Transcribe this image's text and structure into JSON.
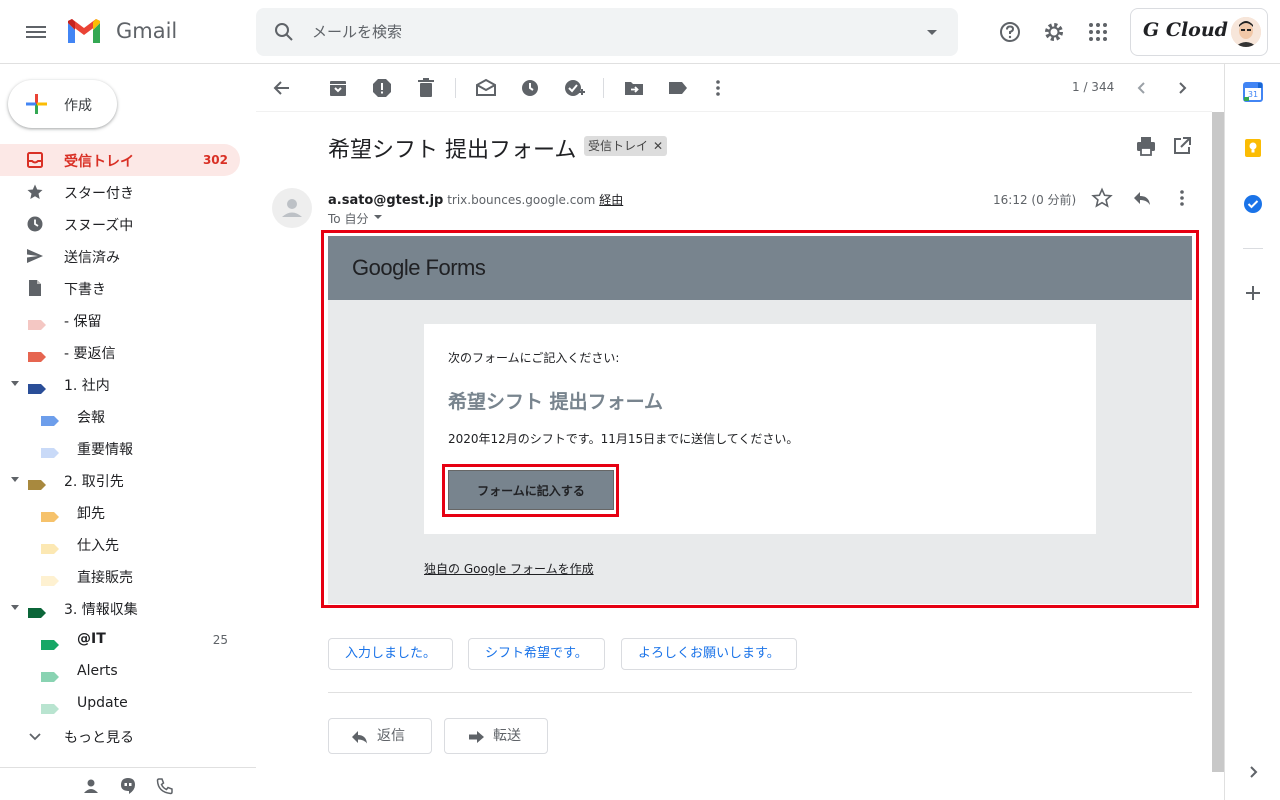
{
  "header": {
    "app_name": "Gmail",
    "search_placeholder": "メールを検索",
    "account_brand": "G Cloud"
  },
  "sidebar": {
    "compose_label": "作成",
    "items": [
      {
        "label": "受信トレイ",
        "count": "302",
        "icon": "inbox-icon"
      },
      {
        "label": "スター付き",
        "count": "",
        "icon": "star-icon"
      },
      {
        "label": "スヌーズ中",
        "count": "",
        "icon": "clock-icon"
      },
      {
        "label": "送信済み",
        "count": "",
        "icon": "send-icon"
      },
      {
        "label": "下書き",
        "count": "",
        "icon": "draft-icon"
      },
      {
        "label": "- 保留",
        "count": "",
        "color": "#f4c7c3"
      },
      {
        "label": "- 要返信",
        "count": "",
        "color": "#e66550"
      },
      {
        "label": "1. 社内",
        "count": "",
        "color": "#2a4e98"
      },
      {
        "label": "会報",
        "count": "",
        "color": "#6d9eeb"
      },
      {
        "label": "重要情報",
        "count": "",
        "color": "#c9daf8"
      },
      {
        "label": "2. 取引先",
        "count": "",
        "color": "#a8893e"
      },
      {
        "label": "卸先",
        "count": "",
        "color": "#f6c26b"
      },
      {
        "label": "仕入先",
        "count": "",
        "color": "#fce8b3"
      },
      {
        "label": "直接販売",
        "count": "",
        "color": "#fef1d1"
      },
      {
        "label": "3. 情報収集",
        "count": "",
        "color": "#0b6639"
      },
      {
        "label": "@IT",
        "count": "25",
        "color": "#16a766"
      },
      {
        "label": "Alerts",
        "count": "",
        "color": "#89d3b2"
      },
      {
        "label": "Update",
        "count": "",
        "color": "#b9e4d0"
      },
      {
        "label": "もっと見る",
        "count": "",
        "icon": "chevron-down-icon"
      }
    ]
  },
  "toolbar": {
    "pager": "1 / 344"
  },
  "email": {
    "subject": "希望シフト 提出フォーム",
    "label_chip": "受信トレイ",
    "sender_email": "a.sato@gtest.jp",
    "via_domain": "trix.bounces.google.com",
    "via_label": "経由",
    "to_line": "To 自分",
    "time": "16:12 (0 分前)"
  },
  "form": {
    "logo": "Google Forms",
    "intro": "次のフォームにご記入ください:",
    "title": "希望シフト 提出フォーム",
    "description": "2020年12月のシフトです。11月15日までに送信してください。",
    "button_label": "フォームに記入する",
    "create_link": "独自の Google フォームを作成"
  },
  "smart_replies": [
    "入力しました。",
    "シフト希望です。",
    "よろしくお願いします。"
  ],
  "actions": {
    "reply": "返信",
    "forward": "転送"
  },
  "colors": {
    "highlight": "#e60012",
    "form_theme": "#78848e",
    "active_red": "#d93025",
    "link_blue": "#1a73e8"
  }
}
